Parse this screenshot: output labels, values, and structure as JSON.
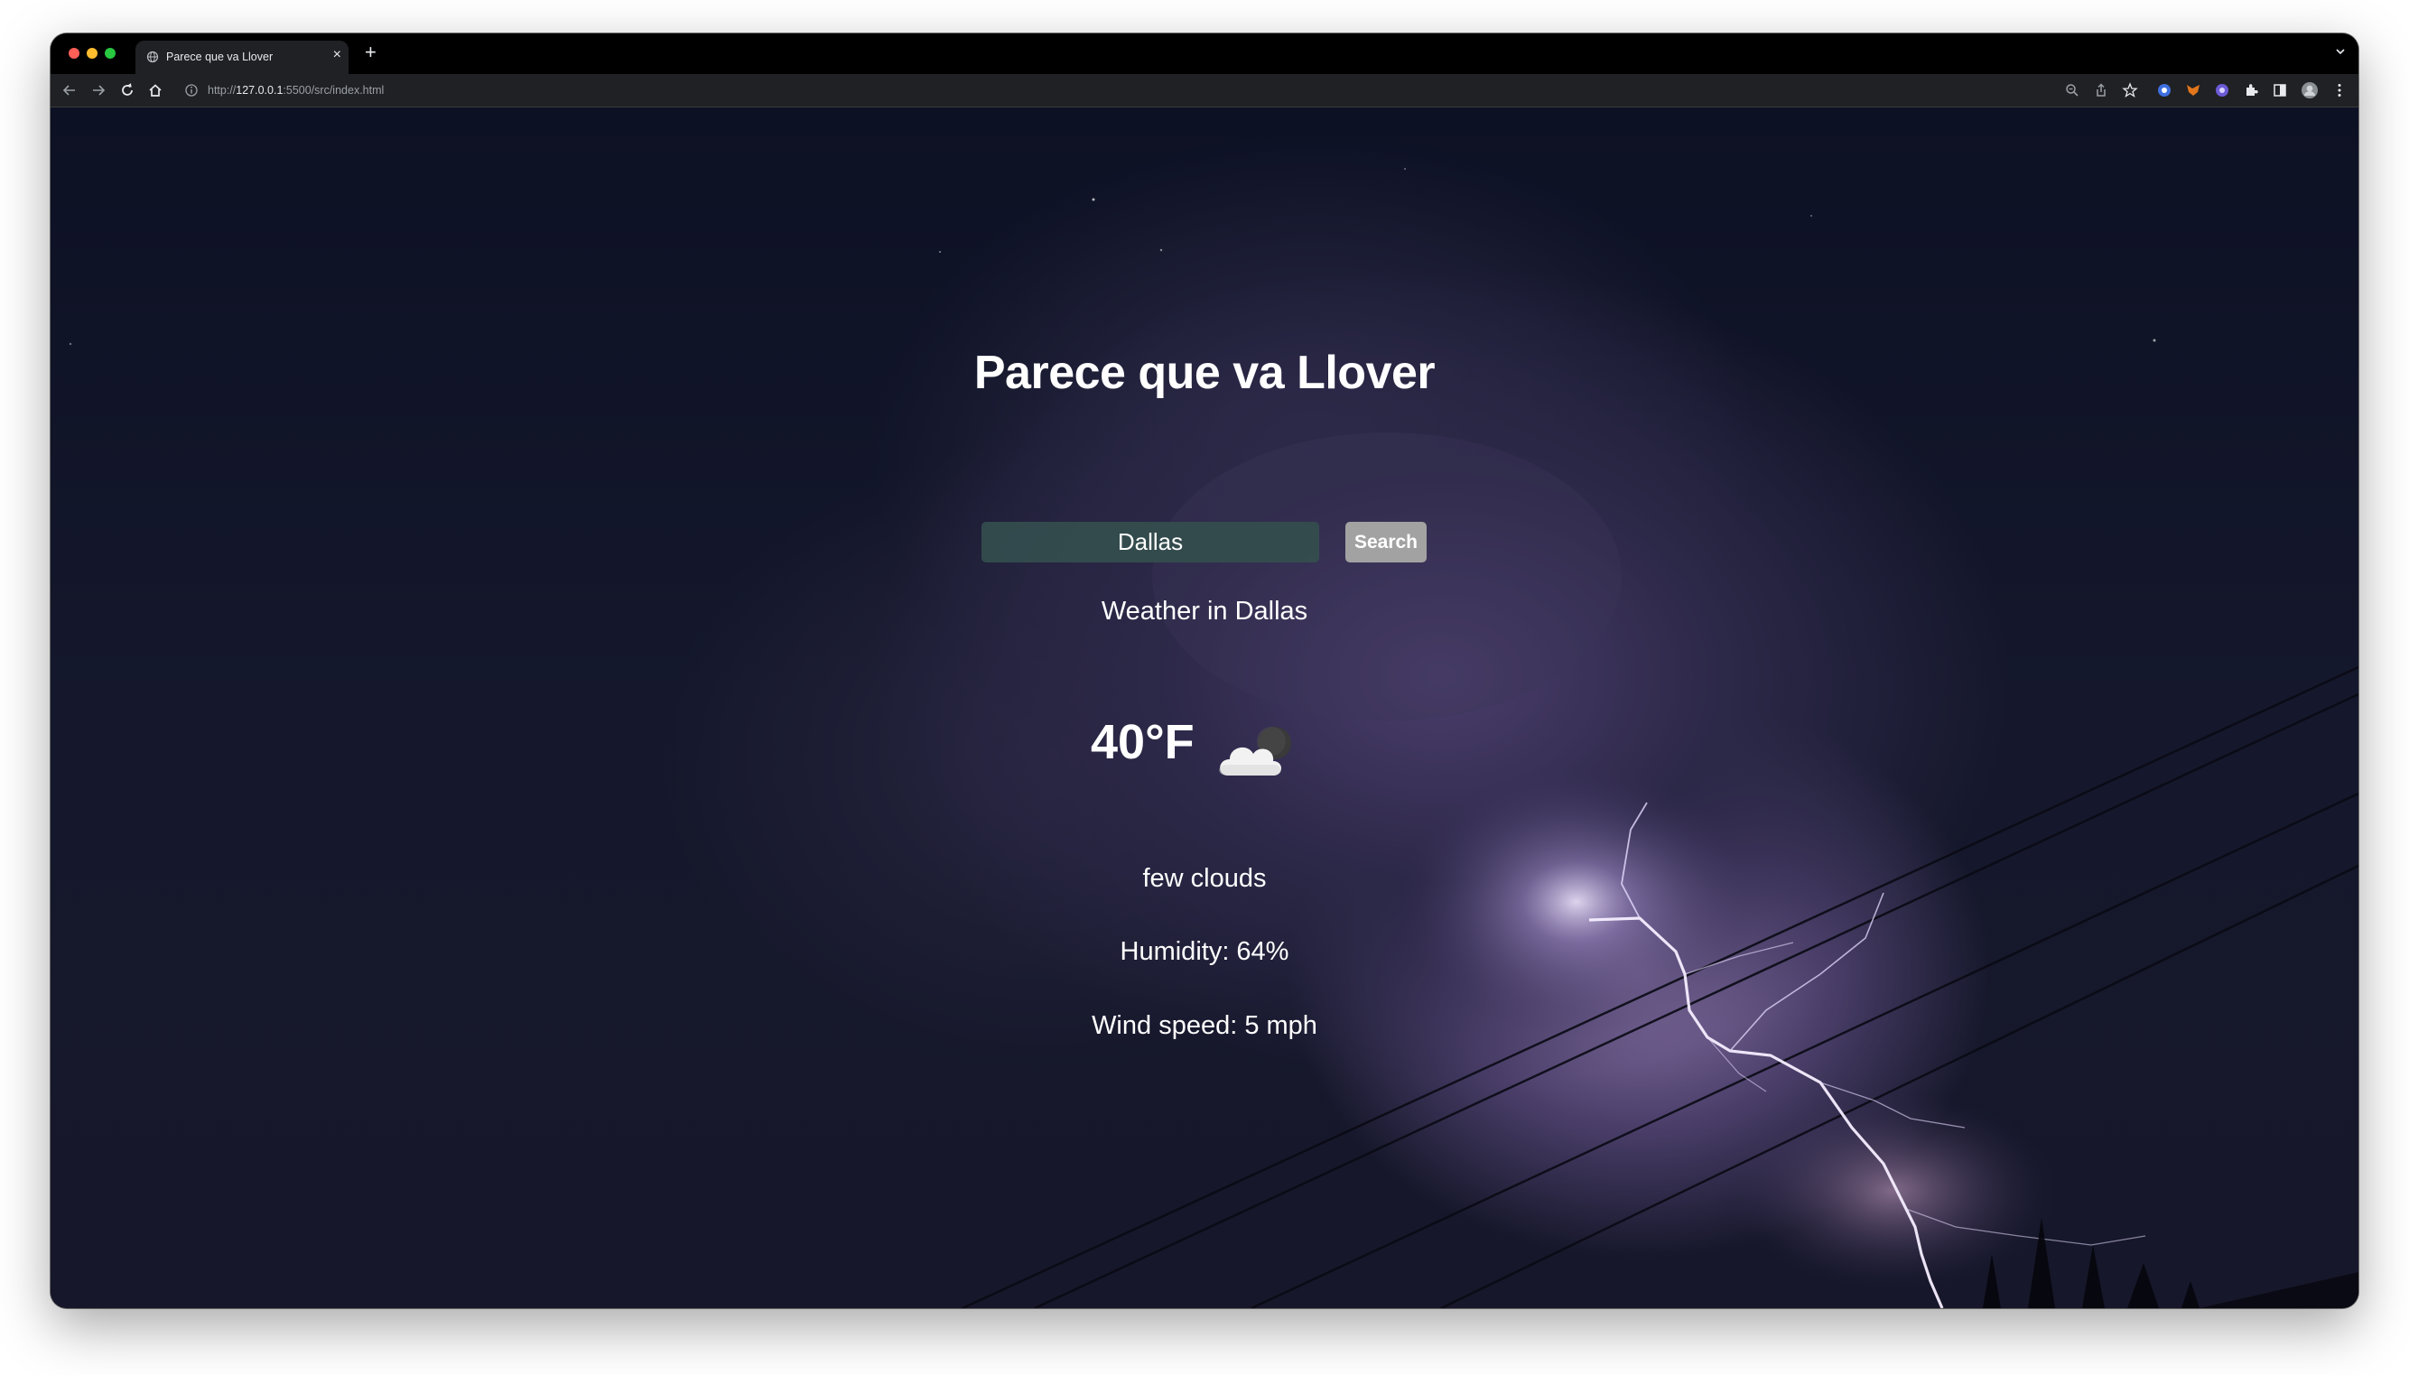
{
  "browser": {
    "tab_title": "Parece que va Llover",
    "new_tab_symbol": "+",
    "tab_close_symbol": "×",
    "url_prefix": "http://",
    "url_host": "127.0.0.1",
    "url_rest": ":5500/src/index.html"
  },
  "app": {
    "title": "Parece que va Llover",
    "search": {
      "value": "Dallas",
      "button_label": "Search"
    },
    "weather": {
      "city_heading": "Weather in Dallas",
      "temperature": "40°F",
      "icon": "few-clouds-night-icon",
      "description": "few clouds",
      "humidity": "Humidity: 64%",
      "wind": "Wind speed: 5 mph"
    }
  },
  "colors": {
    "input_bg": "#344e4e",
    "button_bg": "#a2a2a2",
    "text": "#ffffff"
  }
}
